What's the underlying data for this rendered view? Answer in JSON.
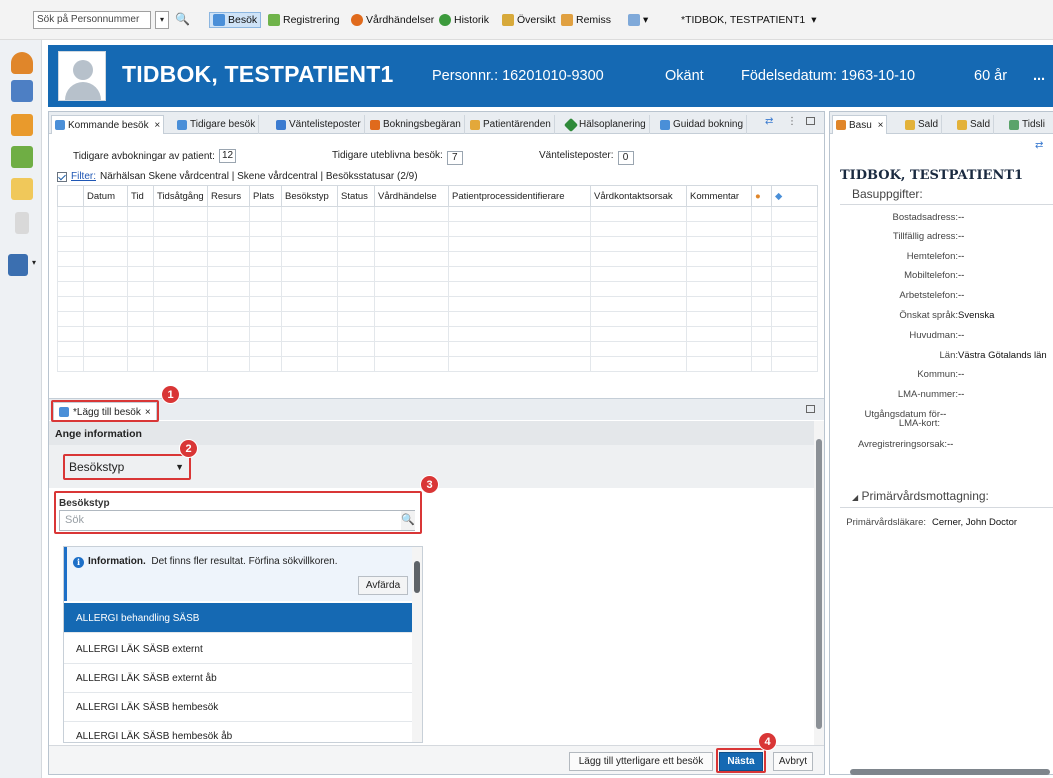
{
  "toolbar": {
    "search_placeholder": "Sök på Personnummer",
    "items": [
      "Besök",
      "Registrering",
      "Vårdhändelser",
      "Historik",
      "Översikt",
      "Remiss"
    ],
    "patient_dropdown": "*TIDBOK, TESTPATIENT1"
  },
  "patient": {
    "name": "TIDBOK, TESTPATIENT1",
    "personnr": "Personnr.: 16201010-9300",
    "gender": "Okänt",
    "birthdate": "Födelsedatum: 1963-10-10",
    "age": "60 år",
    "more": "..."
  },
  "main_tabs": [
    "Kommande besök",
    "Tidigare besök",
    "Väntelisteposter",
    "Bokningsbegäran",
    "Patientärenden",
    "Hälsoplanering",
    "Guidad bokning"
  ],
  "stats": {
    "avbokningar_label": "Tidigare avbokningar av patient:",
    "avbokningar_value": "12",
    "uteblivna_label": "Tidigare uteblivna besök:",
    "uteblivna_value": "7",
    "vantelista_label": "Väntelisteposter:",
    "vantelista_value": "0"
  },
  "filter": {
    "link": "Filter:",
    "text": "Närhälsan Skene vårdcentral | Skene vårdcentral | Besöksstatusar (2/9)"
  },
  "table_headers": [
    "Datum",
    "Tid",
    "Tidsåtgång",
    "Resurs",
    "Plats",
    "Besökstyp",
    "Status",
    "Vårdhändelse",
    "Patientprocessidentifierare",
    "Vårdkontaktsorsak",
    "Kommentar"
  ],
  "lower": {
    "tab_label": "*Lägg till besök",
    "ange_info": "Ange information",
    "select_value": "Besökstyp",
    "section_title": "Besökstyp",
    "search_placeholder": "Sök",
    "info_bold": "Information.",
    "info_text": "Det finns fler resultat. Förfina sökvillkoren.",
    "dismiss": "Avfärda",
    "results": [
      "ALLERGI behandling SÄSB",
      "ALLERGI LÄK SÄSB externt",
      "ALLERGI LÄK SÄSB externt åb",
      "ALLERGI LÄK SÄSB hembesök",
      "ALLERGI LÄK SÄSB hembesök åb"
    ],
    "btn_add_more": "Lägg till ytterligare ett besök",
    "btn_next": "Nästa",
    "btn_cancel": "Avbryt"
  },
  "badges": [
    "1",
    "2",
    "3",
    "4"
  ],
  "right": {
    "tabs": [
      "Basu",
      "Sald",
      "Sald",
      "Tidsli"
    ],
    "title": "TIDBOK, TESTPATIENT1",
    "subtitle": "Basuppgifter:",
    "fields": [
      {
        "k": "Bostadsadress:",
        "v": "--"
      },
      {
        "k": "Tillfällig adress:",
        "v": "--"
      },
      {
        "k": "Hemtelefon:",
        "v": "--"
      },
      {
        "k": "Mobiltelefon:",
        "v": "--"
      },
      {
        "k": "Arbetstelefon:",
        "v": "--"
      },
      {
        "k": "Önskat språk:",
        "v": "Svenska"
      },
      {
        "k": "Huvudman:",
        "v": "--"
      },
      {
        "k": "Län:",
        "v": "Västra Götalands län"
      },
      {
        "k": "Kommun:",
        "v": "--"
      },
      {
        "k": "LMA-nummer:",
        "v": "--"
      },
      {
        "k": "Utgångsdatum för",
        "v": "--"
      },
      {
        "k": "LMA-kort:",
        "v": ""
      },
      {
        "k": "Avregistreringsorsak:",
        "v": "--"
      }
    ],
    "section2": "Primärvårdsmottagning:",
    "pvl_label": "Primärvårdsläkare:",
    "pvl_value": "Cerner, John Doctor"
  },
  "colors": {
    "brand_blue": "#1569b3",
    "highlight_red": "#d93636"
  }
}
